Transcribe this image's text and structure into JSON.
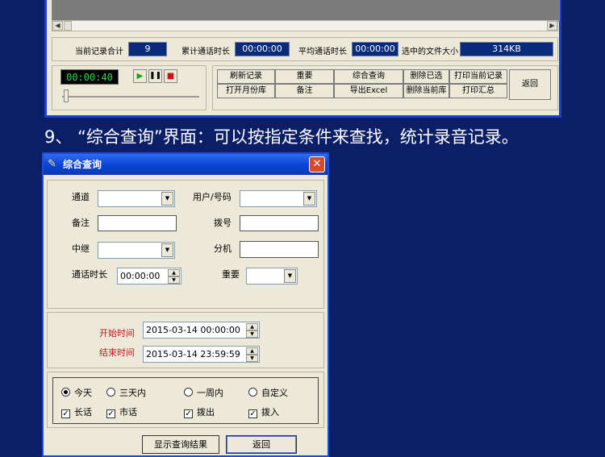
{
  "stats": {
    "total_records_label": "当前记录合计",
    "total_records_value": "9",
    "total_duration_label": "累计通话时长",
    "total_duration_value": "00:00:00",
    "avg_duration_label": "平均通话时长",
    "avg_duration_value": "00:00:00",
    "file_size_label": "选中的文件大小",
    "file_size_value": "314KB"
  },
  "player": {
    "time": "00:00:40",
    "play_icon": "play-icon",
    "pause_icon": "pause-icon",
    "stop_icon": "stop-icon"
  },
  "toolbar": {
    "refresh": "刷新记录",
    "important": "重要",
    "query": "综合查询",
    "delete_selected": "删除已选",
    "print_current": "打印当前记录",
    "back": "返回",
    "open_month": "打开月份库",
    "note": "备注",
    "export_excel": "导出Excel",
    "delete_current_lib": "删除当前库",
    "print_summary": "打印汇总"
  },
  "heading": "9、 “综合查询”界面：可以按指定条件来查找，统计录音记录。",
  "dialog": {
    "title": "综合查询",
    "icon": "app-icon",
    "close": "✕",
    "fields": {
      "channel_label": "通道",
      "user_label": "用户/号码",
      "note_label": "备注",
      "dial_label": "拨号",
      "trunk_label": "中继",
      "ext_label": "分机",
      "duration_label": "通话时长",
      "duration_value": "00:00:00",
      "important_label": "重要"
    },
    "time": {
      "start_label": "开始时间",
      "start_value": "2015-03-14 00:00:00",
      "end_label": "结束时间",
      "end_value": "2015-03-14 23:59:59"
    },
    "options": {
      "today": "今天",
      "three_days": "三天内",
      "one_week": "一周内",
      "custom": "自定义",
      "long_distance": "长话",
      "local": "市话",
      "outgoing": "拨出",
      "incoming": "拨入"
    },
    "buttons": {
      "show_results": "显示查询结果",
      "back": "返回"
    }
  },
  "colors": {
    "page_bg": "#0c1e66",
    "window_bg": "#ece9d8",
    "titlebar": "#0b45d8",
    "value_box": "#0a2a7a",
    "time_text": "#c8141e"
  }
}
